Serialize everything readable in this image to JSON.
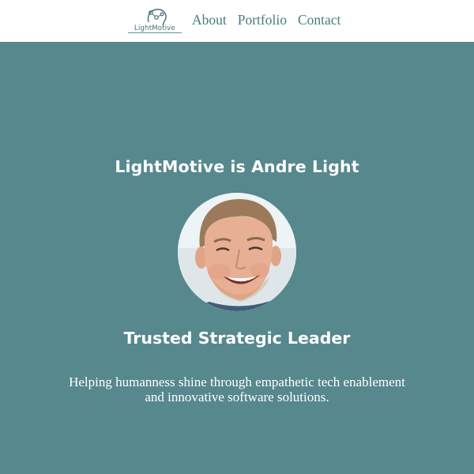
{
  "header": {
    "logo_text": "LightMotive",
    "nav": [
      {
        "label": "About"
      },
      {
        "label": "Portfolio"
      },
      {
        "label": "Contact"
      }
    ]
  },
  "hero": {
    "title": "LightMotive is Andre Light",
    "subtitle": "Trusted Strategic Leader",
    "tagline_line1": "Helping humanness shine through empathetic tech enablement",
    "tagline_line2": "and innovative software solutions."
  },
  "colors": {
    "background": "#56888d",
    "header_bg": "#ffffff",
    "nav_text": "#4a7a82",
    "hero_text": "#ffffff"
  }
}
